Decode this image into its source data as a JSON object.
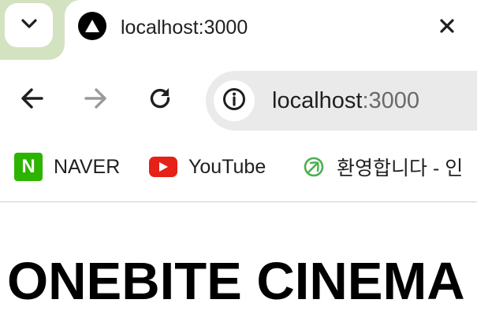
{
  "browser": {
    "accent_color": "#d3e3c2",
    "tab": {
      "title": "localhost:3000",
      "favicon": "triangle-logo-icon",
      "close_icon": "close-icon"
    },
    "tab_search_icon": "chevron-down-icon",
    "toolbar": {
      "back_icon": "arrow-left-icon",
      "forward_icon": "arrow-right-icon",
      "reload_icon": "reload-icon",
      "site_info_icon": "info-icon",
      "url_host": "localhost",
      "url_port": ":3000"
    },
    "bookmarks": [
      {
        "label": "NAVER",
        "icon": "naver-icon",
        "icon_letter": "N",
        "color": "#2db400"
      },
      {
        "label": "YouTube",
        "icon": "youtube-icon",
        "color": "#e62117"
      },
      {
        "label": "환영합니다 - 인",
        "icon": "leaf-icon",
        "color": "#4caf50"
      }
    ]
  },
  "page": {
    "heading": "ONEBITE CINEMA"
  }
}
